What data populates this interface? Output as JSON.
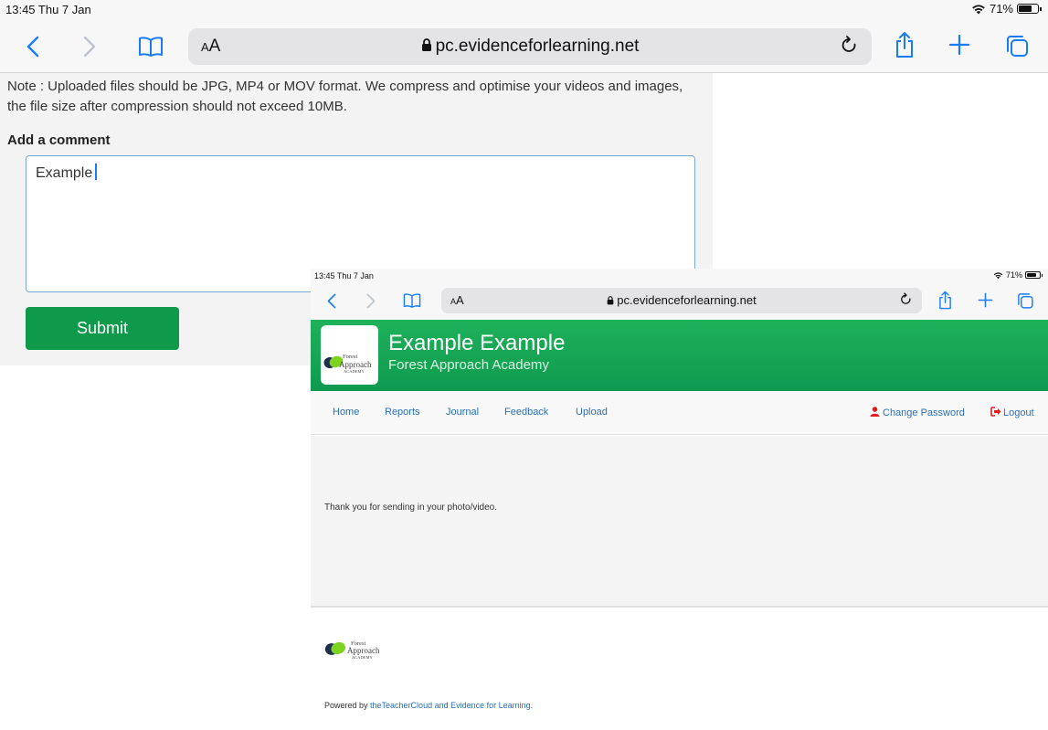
{
  "background": {
    "status_bar": {
      "time": "13:45  Thu 7 Jan",
      "battery": "71%"
    },
    "toolbar": {
      "text_size": "AA",
      "url": "pc.evidenceforlearning.net"
    },
    "note": "Note : Uploaded files should be JPG, MP4 or MOV format. We compress and optimise your videos and images, the file size after compression should not exceed 10MB.",
    "comment_label": "Add a comment",
    "comment_value": "Example",
    "submit_label": "Submit"
  },
  "overlay": {
    "status_bar": {
      "time": "13:45  Thu 7 Jan",
      "battery": "71%"
    },
    "toolbar": {
      "text_size": "AA",
      "url": "pc.evidenceforlearning.net"
    },
    "header": {
      "name": "Example Example",
      "school": "Forest Approach Academy",
      "logo": {
        "line1": "Forest",
        "line2": "Approach",
        "line3": "ACADEMY"
      }
    },
    "nav": {
      "home": "Home",
      "reports": "Reports",
      "journal": "Journal",
      "feedback": "Feedback",
      "upload": "Upload",
      "change_password": "Change Password",
      "logout": "Logout"
    },
    "message": "Thank you for sending in your photo/video.",
    "footer": {
      "logo": {
        "line1": "Forest",
        "line2": "Approach",
        "line3": "ACADEMY"
      },
      "powered_prefix": "Powered by ",
      "powered_link": "theTeacherCloud and Evidence for Learning",
      "powered_suffix": "."
    }
  },
  "colors": {
    "accent_blue": "#1a7cf5",
    "brand_green": "#0e9a4a",
    "link_blue": "#2a6eb5",
    "alert_red": "#e31b1b"
  }
}
